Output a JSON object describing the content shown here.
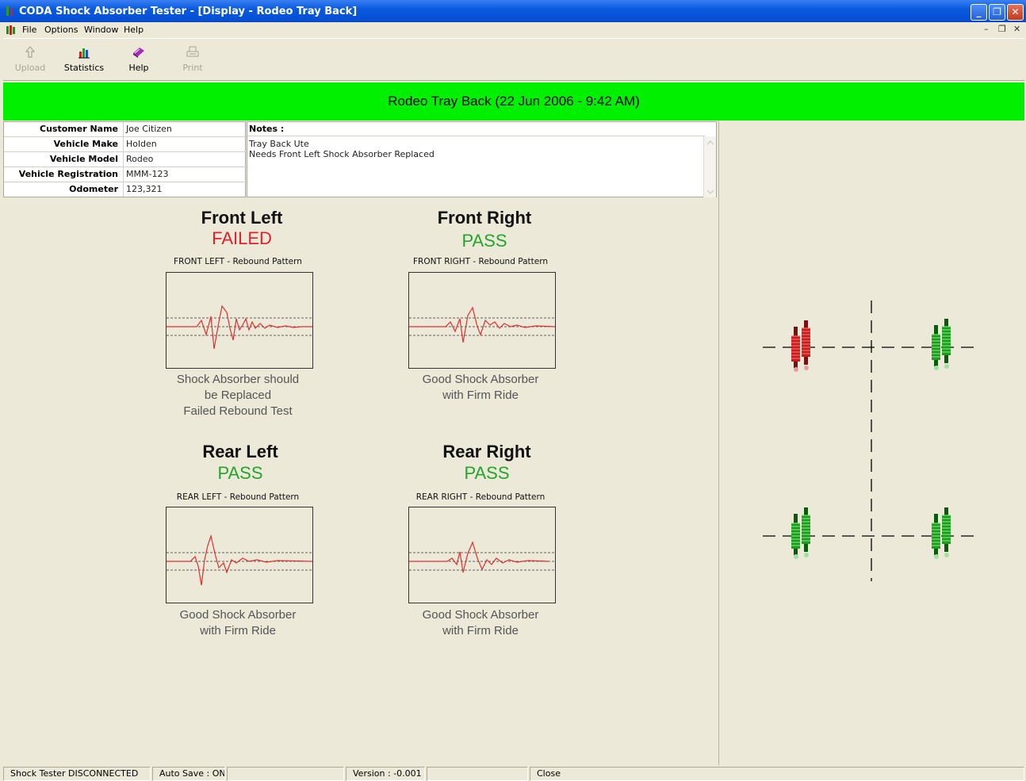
{
  "window": {
    "title": "CODA Shock Absorber Tester - [Display - Rodeo Tray Back]"
  },
  "menu": [
    "File",
    "Options",
    "Window",
    "Help"
  ],
  "toolbar": {
    "upload": "Upload",
    "statistics": "Statistics",
    "help": "Help",
    "print": "Print"
  },
  "banner": "Rodeo Tray Back  (22 Jun 2006 - 9:42 AM)",
  "info": {
    "rows": [
      {
        "label": "Customer Name",
        "value": "Joe Citizen"
      },
      {
        "label": "Vehicle Make",
        "value": "Holden"
      },
      {
        "label": "Vehicle Model",
        "value": "Rodeo"
      },
      {
        "label": "Vehicle Registration",
        "value": "MMM-123"
      },
      {
        "label": "Odometer",
        "value": "123,321"
      }
    ]
  },
  "notes": {
    "label": "Notes :",
    "line1": "Tray Back Ute",
    "line2": "Needs Front Left Shock Absorber Replaced"
  },
  "wheels": {
    "front_left": {
      "title": "Front Left",
      "status": "FAILED",
      "caption": "FRONT LEFT  -  Rebound Pattern",
      "diag1": "Shock Absorber should",
      "diag2": "be Replaced",
      "diag3": "Failed Rebound Test"
    },
    "front_right": {
      "title": "Front Right",
      "status": "PASS",
      "caption": "FRONT RIGHT  -  Rebound Pattern",
      "diag1": "Good Shock Absorber",
      "diag2": "with Firm Ride"
    },
    "rear_left": {
      "title": "Rear Left",
      "status": "PASS",
      "caption": "REAR LEFT  -  Rebound Pattern",
      "diag1": "Good Shock Absorber",
      "diag2": "with Firm Ride"
    },
    "rear_right": {
      "title": "Rear Right",
      "status": "PASS",
      "caption": "REAR RIGHT  -  Rebound Pattern",
      "diag1": "Good Shock Absorber",
      "diag2": "with Firm Ride"
    }
  },
  "statusbar": {
    "connection": "Shock Tester DISCONNECTED",
    "autosave": "Auto Save : ON",
    "version": "Version : -0.001",
    "close": "Close"
  },
  "colors": {
    "banner": "#00f000",
    "fail": "#e3202a",
    "pass": "#22a52a",
    "trace": "#e03030"
  }
}
